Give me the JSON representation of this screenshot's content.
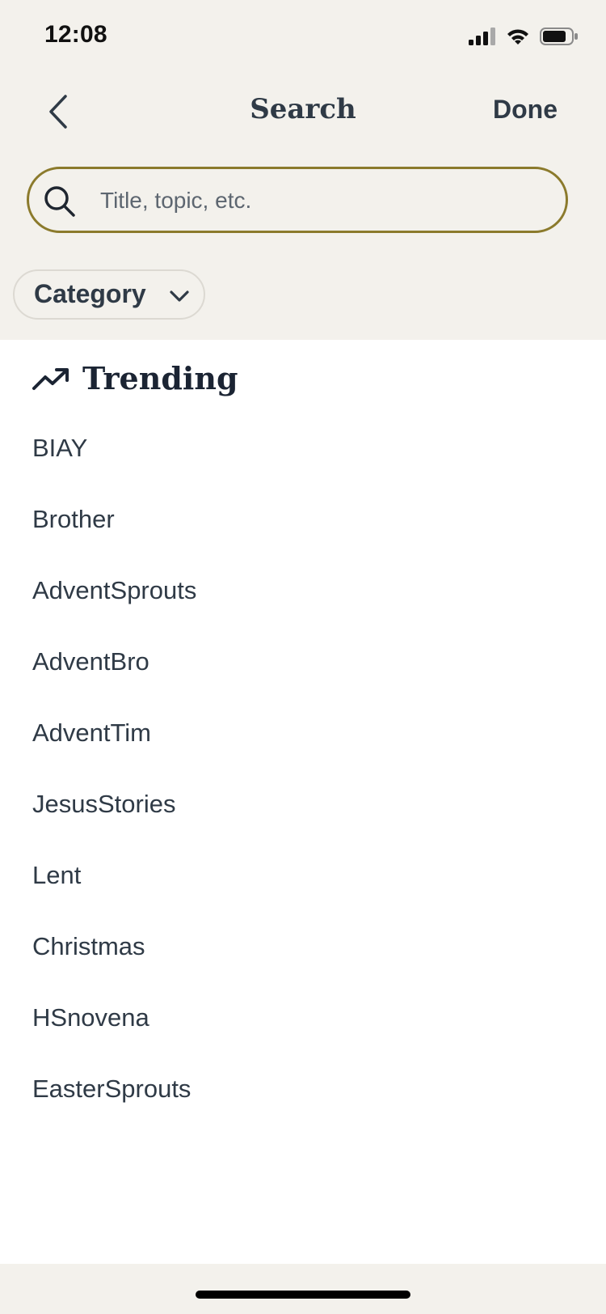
{
  "status_bar": {
    "time": "12:08"
  },
  "nav": {
    "title": "Search",
    "done_label": "Done"
  },
  "search": {
    "placeholder": "Title, topic, etc.",
    "value": ""
  },
  "filters": {
    "category_label": "Category"
  },
  "trending": {
    "title": "Trending",
    "items": [
      "BIAY",
      "Brother",
      "AdventSprouts",
      "AdventBro",
      "AdventTim",
      "JesusStories",
      "Lent",
      "Christmas",
      "HSnovena",
      "EasterSprouts"
    ]
  },
  "colors": {
    "header_bg": "#f3f1ec",
    "search_border": "#8b7a2c",
    "text": "#2f3a46",
    "heading": "#1b2433"
  },
  "icons": {
    "back": "chevron-left-icon",
    "search": "search-icon",
    "category_toggle": "chevron-down-icon",
    "trending": "trending-up-icon"
  }
}
